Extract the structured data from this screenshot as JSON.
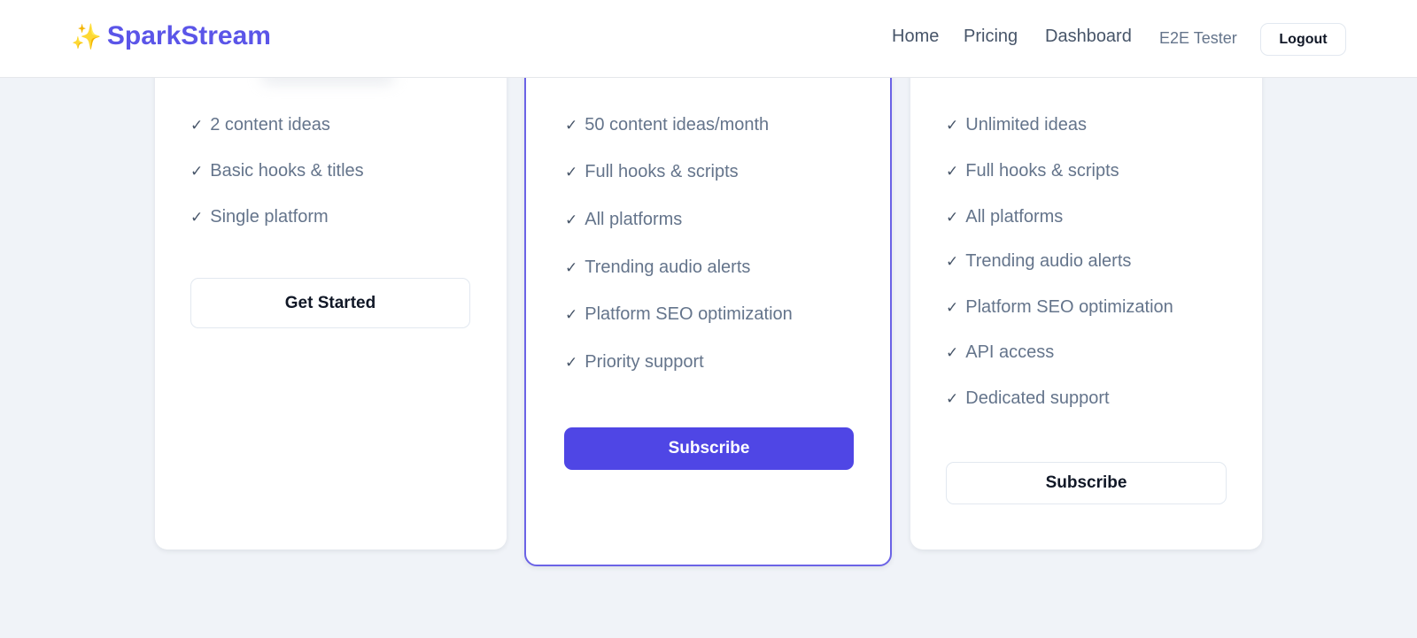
{
  "app": {
    "brand": "SparkStream",
    "brand_icon": "sparkles-icon"
  },
  "header": {
    "nav": [
      {
        "label": "Home"
      },
      {
        "label": "Pricing"
      },
      {
        "label": "Dashboard"
      }
    ],
    "user_name": "E2E Tester",
    "logout_label": "Logout"
  },
  "plans": [
    {
      "features": [
        "2 content ideas",
        "Basic hooks & titles",
        "Single platform"
      ],
      "button_label": "Get Started"
    },
    {
      "features": [
        "50 content ideas/month",
        "Full hooks & scripts",
        "All platforms",
        "Trending audio alerts",
        "Platform SEO optimization",
        "Priority support"
      ],
      "button_label": "Subscribe"
    },
    {
      "features": [
        "Unlimited ideas",
        "Full hooks & scripts",
        "All platforms",
        "Trending audio alerts",
        "Platform SEO optimization",
        "API access",
        "Dedicated support"
      ],
      "button_label": "Subscribe"
    }
  ],
  "check_glyph": "✓",
  "colors": {
    "brand": "#5b55e8",
    "primary_button": "#4f46e5",
    "highlight_border": "#6b63e6",
    "background": "#f0f3f8"
  }
}
